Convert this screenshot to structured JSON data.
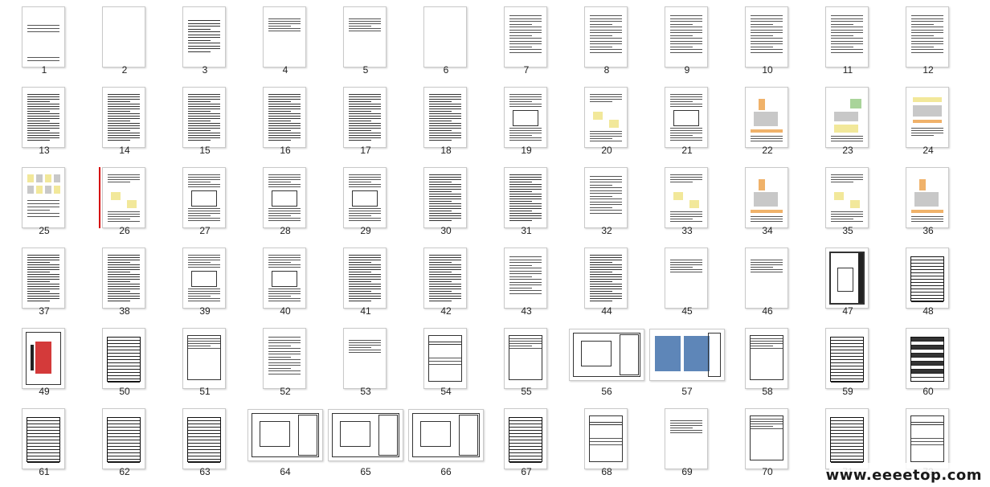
{
  "pages": [
    {
      "label": "1",
      "kind": "cover"
    },
    {
      "label": "2",
      "kind": "blank"
    },
    {
      "label": "3",
      "kind": "toc"
    },
    {
      "label": "4",
      "kind": "text-sparse"
    },
    {
      "label": "5",
      "kind": "text-sparse"
    },
    {
      "label": "6",
      "kind": "blank"
    },
    {
      "label": "7",
      "kind": "text"
    },
    {
      "label": "8",
      "kind": "text"
    },
    {
      "label": "9",
      "kind": "text"
    },
    {
      "label": "10",
      "kind": "text"
    },
    {
      "label": "11",
      "kind": "text"
    },
    {
      "label": "12",
      "kind": "text"
    },
    {
      "label": "13",
      "kind": "text-dense"
    },
    {
      "label": "14",
      "kind": "text-dense"
    },
    {
      "label": "15",
      "kind": "text-dense"
    },
    {
      "label": "16",
      "kind": "text-dense"
    },
    {
      "label": "17",
      "kind": "text-dense"
    },
    {
      "label": "18",
      "kind": "text-dense"
    },
    {
      "label": "19",
      "kind": "text-figure"
    },
    {
      "label": "20",
      "kind": "figure-yellow"
    },
    {
      "label": "21",
      "kind": "text-figure"
    },
    {
      "label": "22",
      "kind": "figure-orange"
    },
    {
      "label": "23",
      "kind": "figure-green"
    },
    {
      "label": "24",
      "kind": "figure-mixed"
    },
    {
      "label": "25",
      "kind": "figure-grid"
    },
    {
      "label": "26",
      "kind": "figure-yellow",
      "current": true
    },
    {
      "label": "27",
      "kind": "text-figure"
    },
    {
      "label": "28",
      "kind": "text-figure"
    },
    {
      "label": "29",
      "kind": "text-figure"
    },
    {
      "label": "30",
      "kind": "text-dense"
    },
    {
      "label": "31",
      "kind": "text-dense"
    },
    {
      "label": "32",
      "kind": "text"
    },
    {
      "label": "33",
      "kind": "figure-yellow"
    },
    {
      "label": "34",
      "kind": "figure-orange"
    },
    {
      "label": "35",
      "kind": "figure-yellow"
    },
    {
      "label": "36",
      "kind": "figure-orange"
    },
    {
      "label": "37",
      "kind": "text-dense"
    },
    {
      "label": "38",
      "kind": "text-dense"
    },
    {
      "label": "39",
      "kind": "text-figure"
    },
    {
      "label": "40",
      "kind": "text-figure"
    },
    {
      "label": "41",
      "kind": "text-dense"
    },
    {
      "label": "42",
      "kind": "text-dense"
    },
    {
      "label": "43",
      "kind": "text"
    },
    {
      "label": "44",
      "kind": "text-dense"
    },
    {
      "label": "45",
      "kind": "text-sparse"
    },
    {
      "label": "46",
      "kind": "text-sparse"
    },
    {
      "label": "47",
      "kind": "drawing"
    },
    {
      "label": "48",
      "kind": "table"
    },
    {
      "label": "49",
      "kind": "drawing-red"
    },
    {
      "label": "50",
      "kind": "table"
    },
    {
      "label": "51",
      "kind": "form"
    },
    {
      "label": "52",
      "kind": "text"
    },
    {
      "label": "53",
      "kind": "text-sparse"
    },
    {
      "label": "54",
      "kind": "form-cover"
    },
    {
      "label": "55",
      "kind": "form"
    },
    {
      "label": "56",
      "kind": "landscape-plan"
    },
    {
      "label": "57",
      "kind": "landscape-photo"
    },
    {
      "label": "58",
      "kind": "form"
    },
    {
      "label": "59",
      "kind": "table"
    },
    {
      "label": "60",
      "kind": "table-dark"
    },
    {
      "label": "61",
      "kind": "table"
    },
    {
      "label": "62",
      "kind": "table"
    },
    {
      "label": "63",
      "kind": "table"
    },
    {
      "label": "64",
      "kind": "landscape-plan"
    },
    {
      "label": "65",
      "kind": "landscape-plan"
    },
    {
      "label": "66",
      "kind": "landscape-plan"
    },
    {
      "label": "67",
      "kind": "table"
    },
    {
      "label": "68",
      "kind": "form-cover"
    },
    {
      "label": "69",
      "kind": "text-sparse"
    },
    {
      "label": "70",
      "kind": "form"
    },
    {
      "label": "71",
      "kind": "table"
    },
    {
      "label": "72",
      "kind": "form-cover"
    }
  ],
  "watermark": "www.eeeetop.com",
  "colors": {
    "selection_marker": "#d60000",
    "thumb_border": "#c9c9c9"
  }
}
